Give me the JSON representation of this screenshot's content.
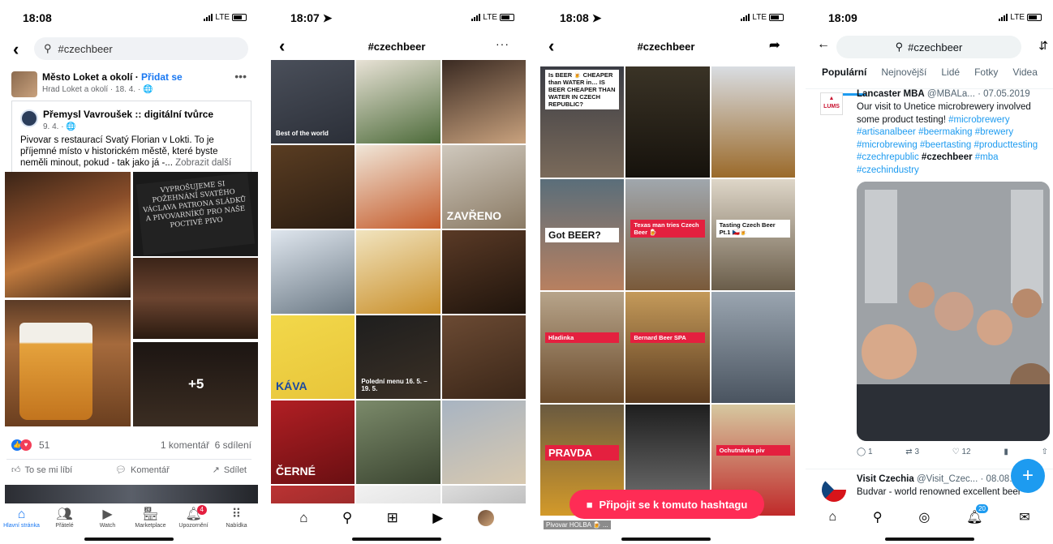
{
  "facebook": {
    "time": "18:08",
    "network": "LTE",
    "search_value": "#czechbeer",
    "post": {
      "page_name": "Město Loket a okolí",
      "separator": " · ",
      "add_link": "Přidat se",
      "sub": "Hrad Loket a okolí · 18. 4. · ",
      "shared_author": "Přemysl Vavroušek :: digitální tvůrce",
      "shared_date": "9. 4. · ",
      "text": "Pivovar s restaurací Svatý Florian v Lokti. To je příjemné místo v historickém městě, které byste neměli minout, pokud - tak jako já -...",
      "see_more": "Zobrazit další",
      "board_text": "VYPROŠUJEME SI POŽEHNÁNÍ SVATÉHO VÁCLAVA PATRONA SLÁDKŮ A PIVOVARNÍKŮ PRO NAŠE POCTIVÉ PIVO",
      "more_photos": "+5",
      "reaction_count": "51",
      "comments": "1 komentář",
      "shares": "6 sdílení",
      "like": "To se mi líbí",
      "comment": "Komentář",
      "share": "Sdílet"
    },
    "tabs": [
      {
        "label": "Hlavní stránka",
        "icon": "home-icon"
      },
      {
        "label": "Přátelé",
        "icon": "friends-icon"
      },
      {
        "label": "Watch",
        "icon": "watch-icon"
      },
      {
        "label": "Marketplace",
        "icon": "marketplace-icon"
      },
      {
        "label": "Upozornění",
        "icon": "bell-icon",
        "badge": "4"
      },
      {
        "label": "Nabídka",
        "icon": "menu-icon"
      }
    ],
    "accent": "#1877f2"
  },
  "instagram": {
    "time": "18:07",
    "network": "LTE",
    "title": "#czechbeer",
    "cells": [
      {
        "bg": "linear-gradient(160deg,#4a4f5a,#2b2f38)",
        "text": "Best of the world"
      },
      {
        "bg": "linear-gradient(160deg,#e8e2d6,#4d6b3a)",
        "text": ""
      },
      {
        "bg": "linear-gradient(160deg,#3a2a22,#c9a27e)",
        "text": ""
      },
      {
        "bg": "linear-gradient(160deg,#5a3d22,#2b1d12)",
        "text": ""
      },
      {
        "bg": "linear-gradient(160deg,#f0e6d8,#c45a2a)",
        "text": ""
      },
      {
        "bg": "linear-gradient(160deg,#cfc8bd,#8a7a64)",
        "text": "ZAVŘENO"
      },
      {
        "bg": "linear-gradient(160deg,#dfe6ee,#6c7a86)",
        "text": ""
      },
      {
        "bg": "linear-gradient(160deg,#f1e4bf,#c98f2a)",
        "text": ""
      },
      {
        "bg": "linear-gradient(160deg,#5a3a26,#1f140c)",
        "text": ""
      },
      {
        "bg": "linear-gradient(160deg,#f2d84a,#e8c53a)",
        "text": "KÁVA"
      },
      {
        "bg": "linear-gradient(160deg,#1e1e1e,#3b3025)",
        "text": "Polední menu 16. 5. – 19. 5."
      },
      {
        "bg": "linear-gradient(160deg,#6b4a33,#3a2618)",
        "text": ""
      },
      {
        "bg": "linear-gradient(160deg,#b11f24,#6a0f12)",
        "text": "ČERNÉ"
      },
      {
        "bg": "linear-gradient(160deg,#7b8a6a,#3a4430)",
        "text": ""
      },
      {
        "bg": "linear-gradient(160deg,#a8b4c2,#d8c9b0)",
        "text": ""
      },
      {
        "bg": "linear-gradient(160deg,#b33,#722)",
        "text": ""
      },
      {
        "bg": "linear-gradient(160deg,#f2f2f2,#ccc)",
        "text": ""
      },
      {
        "bg": "linear-gradient(160deg,#ddd,#999)",
        "text": ""
      }
    ],
    "nav": [
      "home-icon",
      "search-icon",
      "create-icon",
      "reels-icon",
      "profile-avatar"
    ]
  },
  "tiktok": {
    "time": "18:08",
    "network": "LTE",
    "title": "#czechbeer",
    "cells": [
      {
        "bg": "linear-gradient(180deg,#3b3d45,#7a6a5a)",
        "label": "Is BEER 🍺 CHEAPER than WATER in…  IS BEER CHEAPER THAN WATER IN CZECH REPUBLIC?"
      },
      {
        "bg": "linear-gradient(180deg,#3a3326,#16120c)",
        "label": ""
      },
      {
        "bg": "linear-gradient(180deg,#d9dde2,#9b6a2a)",
        "label": ""
      },
      {
        "bg": "linear-gradient(180deg,#5a6e7a,#b88060)",
        "label": "Got BEER?"
      },
      {
        "bg": "linear-gradient(180deg,#a0a7ad,#7a5a3a)",
        "label": "Texas man tries Czech Beer 🍺"
      },
      {
        "bg": "linear-gradient(180deg,#ded6c8,#6a5d4a)",
        "label": "Tasting Czech Beer Pt.1 🇨🇿🍺"
      },
      {
        "bg": "linear-gradient(180deg,#b7a48a,#6a4a2a)",
        "label": "Hladinka"
      },
      {
        "bg": "linear-gradient(180deg,#c49a5a,#5a3a1e)",
        "label": "Bernard Beer SPA"
      },
      {
        "bg": "linear-gradient(180deg,#9aa5b0,#4a5460)",
        "label": ""
      },
      {
        "bg": "linear-gradient(180deg,#6a5a40,#d39a2a)",
        "label": "PRAVDA"
      },
      {
        "bg": "linear-gradient(180deg,#1e1e1e,#777)",
        "label": ""
      },
      {
        "bg": "linear-gradient(180deg,#d6c8a0,#c02a2a)",
        "label": "Ochutnávka piv"
      }
    ],
    "join_cta": "Připojit se k tomuto hashtagu",
    "bottom_caption": "Pivovar HOLBA 🍺 ..."
  },
  "twitter": {
    "time": "18:09",
    "network": "LTE",
    "search_value": "#czechbeer",
    "tabs": [
      "Populární",
      "Nejnovější",
      "Lidé",
      "Fotky",
      "Videa"
    ],
    "tweet1": {
      "name": "Lancaster MBA",
      "handle": "@MBALa... · 07.05.2019",
      "text": "Our visit to Unetice microbrewery involved some product testing!",
      "hashtags": [
        "#microbrewery",
        "#artisanalbeer",
        "#beermaking",
        "#brewery",
        "#microbrewing",
        "#beertasting",
        "#producttesting",
        "#czechrepublic",
        "#czechbeer",
        "#mba",
        "#czechindustry"
      ],
      "replies": "1",
      "retweets": "3",
      "likes": "12"
    },
    "tweet2": {
      "name": "Visit Czechia",
      "handle": "@Visit_Czec... · 08.08.20",
      "text": "Budvar - world renowned excellent beer"
    },
    "notif_badge": "20",
    "accent": "#1d9bf0"
  }
}
